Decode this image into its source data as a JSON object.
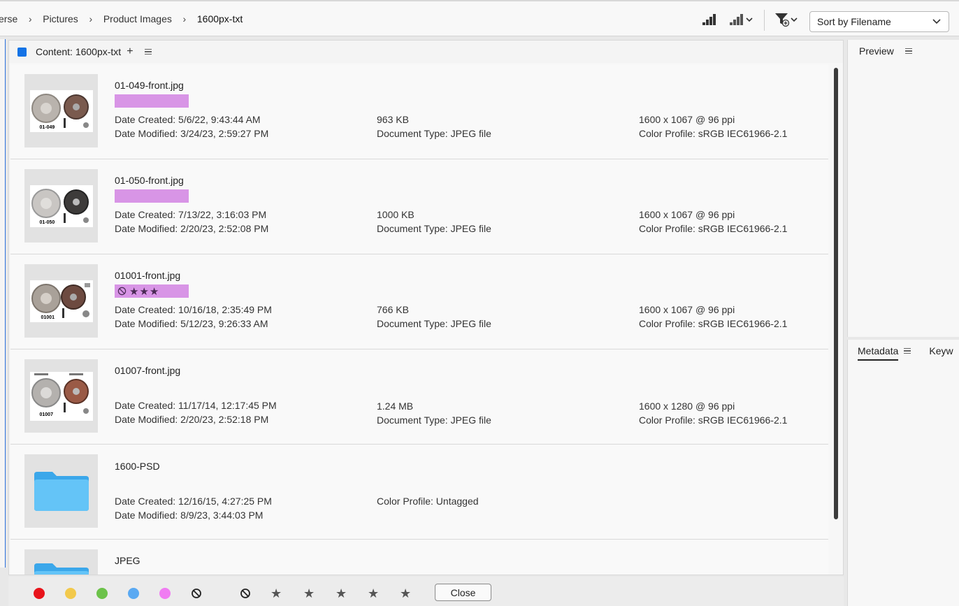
{
  "breadcrumb": {
    "items": [
      "erse",
      "Pictures",
      "Product Images",
      "1600px-txt"
    ]
  },
  "toolbar": {
    "sort_label": "Sort by Filename"
  },
  "content_panel": {
    "title": "Content: 1600px-txt"
  },
  "rows": [
    {
      "name": "01-049-front.jpg",
      "thumb_caption": "01-049",
      "rating": "",
      "date_created": "Date Created: 5/6/22, 9:43:44 AM",
      "date_modified": "Date Modified: 3/24/23, 2:59:27 PM",
      "size": "963 KB",
      "doc_type": "Document Type: JPEG file",
      "dimensions": "1600 x 1067 @ 96 ppi",
      "color_profile": "Color Profile: sRGB IEC61966-2.1"
    },
    {
      "name": "01-050-front.jpg",
      "thumb_caption": "01-050",
      "rating": "",
      "date_created": "Date Created: 7/13/22, 3:16:03 PM",
      "date_modified": "Date Modified: 2/20/23, 2:52:08 PM",
      "size": "1000 KB",
      "doc_type": "Document Type: JPEG file",
      "dimensions": "1600 x 1067 @ 96 ppi",
      "color_profile": "Color Profile: sRGB IEC61966-2.1"
    },
    {
      "name": "01001-front.jpg",
      "thumb_caption": "01001",
      "rating": "★★★",
      "date_created": "Date Created: 10/16/18, 2:35:49 PM",
      "date_modified": "Date Modified: 5/12/23, 9:26:33 AM",
      "size": "766 KB",
      "doc_type": "Document Type: JPEG file",
      "dimensions": "1600 x 1067 @ 96 ppi",
      "color_profile": "Color Profile: sRGB IEC61966-2.1"
    },
    {
      "name": "01007-front.jpg",
      "thumb_caption": "01007",
      "rating": "",
      "date_created": "Date Created: 11/17/14, 12:17:45 PM",
      "date_modified": "Date Modified: 2/20/23, 2:52:18 PM",
      "size": "1.24 MB",
      "doc_type": "Document Type: JPEG file",
      "dimensions": "1600 x 1280 @ 96 ppi",
      "color_profile": "Color Profile: sRGB IEC61966-2.1"
    },
    {
      "name": "1600-PSD",
      "date_created": "Date Created: 12/16/15, 4:27:25 PM",
      "date_modified": "Date Modified: 8/9/23, 3:44:03 PM",
      "color_profile": "Color Profile: Untagged"
    },
    {
      "name": "JPEG"
    }
  ],
  "right_panels": {
    "preview_title": "Preview",
    "metadata_tab": "Metadata",
    "keywords_tab": "Keyw"
  },
  "bottom_bar": {
    "label_colors": [
      "#e8141b",
      "#f2c94c",
      "#6cc24a",
      "#5aa9f2",
      "#f07cf2"
    ],
    "close_label": "Close"
  }
}
